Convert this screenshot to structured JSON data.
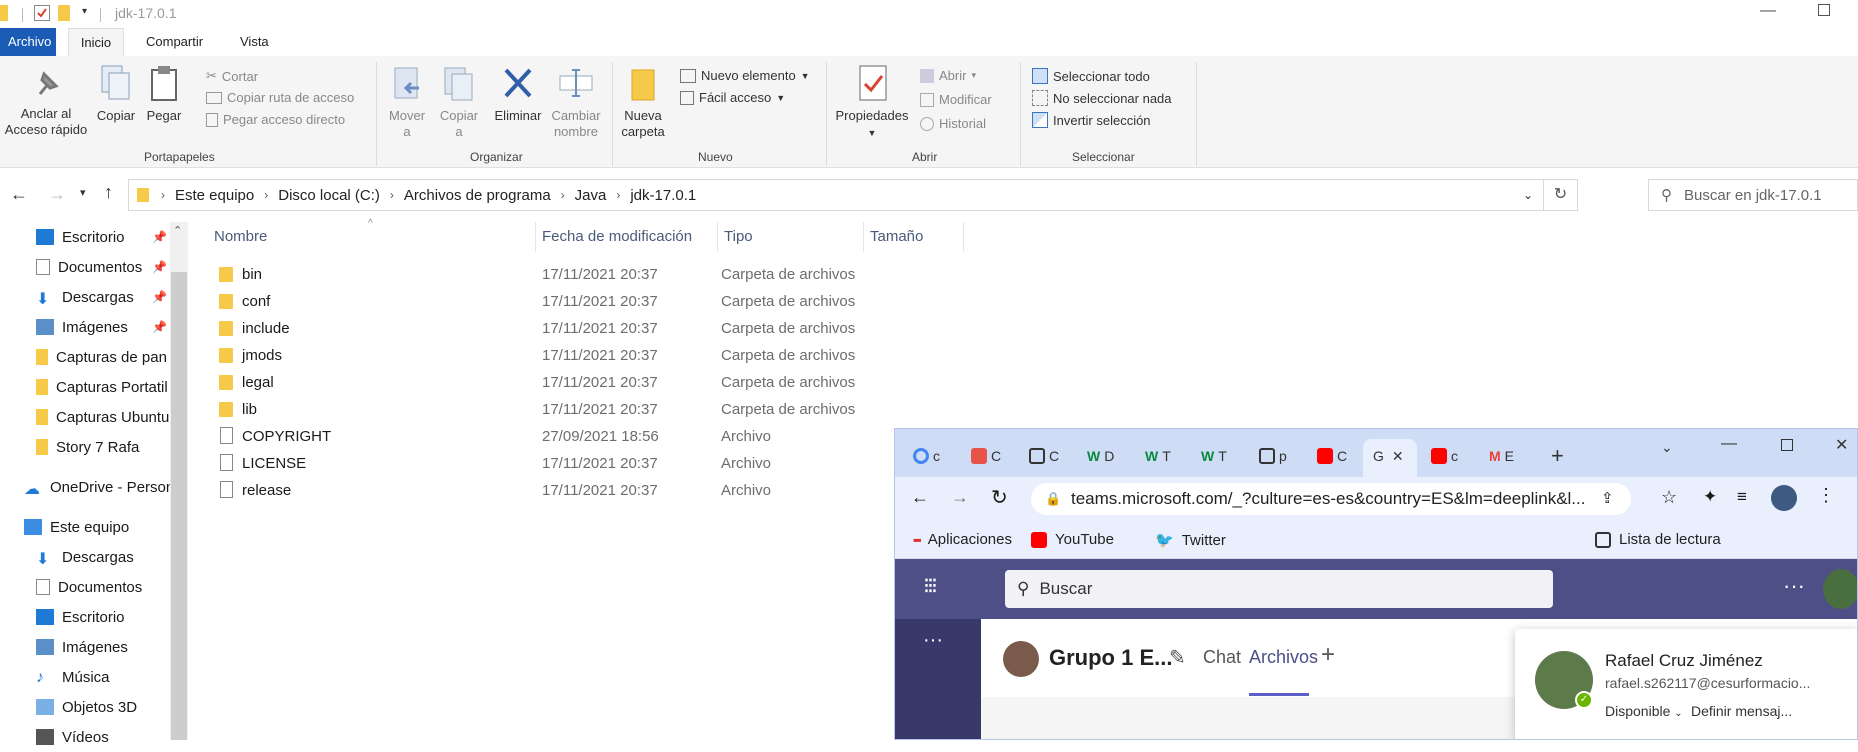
{
  "window": {
    "title": "jdk-17.0.1"
  },
  "ribbon_tabs": [
    "Archivo",
    "Inicio",
    "Compartir",
    "Vista"
  ],
  "ribbon": {
    "portapapeles": {
      "group_label": "Portapapeles",
      "pin_label_1": "Anclar al",
      "pin_label_2": "Acceso rápido",
      "copy_label": "Copiar",
      "paste_label": "Pegar",
      "cut_label": "Cortar",
      "copy_path_label": "Copiar ruta de acceso",
      "paste_shortcut_label": "Pegar acceso directo"
    },
    "organizar": {
      "group_label": "Organizar",
      "move_label_1": "Mover",
      "move_label_2": "a",
      "copyto_label_1": "Copiar",
      "copyto_label_2": "a",
      "delete_label": "Eliminar",
      "rename_label_1": "Cambiar",
      "rename_label_2": "nombre"
    },
    "nuevo": {
      "group_label": "Nuevo",
      "newfolder_label_1": "Nueva",
      "newfolder_label_2": "carpeta",
      "newitem_label": "Nuevo elemento",
      "easyaccess_label": "Fácil acceso"
    },
    "abrir": {
      "group_label": "Abrir",
      "properties_label": "Propiedades",
      "open_label": "Abrir",
      "edit_label": "Modificar",
      "history_label": "Historial"
    },
    "seleccionar": {
      "group_label": "Seleccionar",
      "select_all_label": "Seleccionar todo",
      "select_none_label": "No seleccionar nada",
      "invert_label": "Invertir selección"
    }
  },
  "address": {
    "crumbs": [
      "Este equipo",
      "Disco local (C:)",
      "Archivos de programa",
      "Java",
      "jdk-17.0.1"
    ],
    "search_placeholder": "Buscar en jdk-17.0.1"
  },
  "nav": {
    "quick": [
      {
        "label": "Escritorio",
        "pinned": true
      },
      {
        "label": "Documentos",
        "pinned": true
      },
      {
        "label": "Descargas",
        "pinned": true
      },
      {
        "label": "Imágenes",
        "pinned": true
      },
      {
        "label": "Capturas de pan",
        "pinned": false
      },
      {
        "label": "Capturas Portatil",
        "pinned": false
      },
      {
        "label": "Capturas Ubuntu",
        "pinned": false
      },
      {
        "label": "Story 7 Rafa",
        "pinned": false
      }
    ],
    "onedrive": "OneDrive - Person",
    "thispc": "Este equipo",
    "pc_items": [
      "Descargas",
      "Documentos",
      "Escritorio",
      "Imágenes",
      "Música",
      "Objetos 3D",
      "Vídeos"
    ]
  },
  "columns": {
    "name": "Nombre",
    "modified": "Fecha de modificación",
    "type": "Tipo",
    "size": "Tamaño"
  },
  "files": [
    {
      "name": "bin",
      "date": "17/11/2021 20:37",
      "type": "Carpeta de archivos",
      "kind": "folder"
    },
    {
      "name": "conf",
      "date": "17/11/2021 20:37",
      "type": "Carpeta de archivos",
      "kind": "folder"
    },
    {
      "name": "include",
      "date": "17/11/2021 20:37",
      "type": "Carpeta de archivos",
      "kind": "folder"
    },
    {
      "name": "jmods",
      "date": "17/11/2021 20:37",
      "type": "Carpeta de archivos",
      "kind": "folder"
    },
    {
      "name": "legal",
      "date": "17/11/2021 20:37",
      "type": "Carpeta de archivos",
      "kind": "folder"
    },
    {
      "name": "lib",
      "date": "17/11/2021 20:37",
      "type": "Carpeta de archivos",
      "kind": "folder"
    },
    {
      "name": "COPYRIGHT",
      "date": "27/09/2021 18:56",
      "type": "Archivo",
      "kind": "file"
    },
    {
      "name": "LICENSE",
      "date": "17/11/2021 20:37",
      "type": "Archivo",
      "kind": "file"
    },
    {
      "name": "release",
      "date": "17/11/2021 20:37",
      "type": "Archivo",
      "kind": "file"
    }
  ],
  "chrome": {
    "tabs": [
      {
        "letter": "c",
        "icon": "google-icon",
        "color": "#4285f4"
      },
      {
        "letter": "C",
        "icon": "app-icon",
        "color": "#e8534a"
      },
      {
        "letter": "C",
        "icon": "cube-icon",
        "color": "#333333"
      },
      {
        "letter": "D",
        "icon": "wordpress-icon",
        "color": "#0b8a3e"
      },
      {
        "letter": "T",
        "icon": "wordpress-icon",
        "color": "#0b8a3e"
      },
      {
        "letter": "T",
        "icon": "wordpress-icon",
        "color": "#0b8a3e"
      },
      {
        "letter": "p",
        "icon": "cube-icon",
        "color": "#333333"
      },
      {
        "letter": "C",
        "icon": "youtube-icon",
        "color": "#ff0000"
      },
      {
        "letter": "G",
        "icon": "",
        "color": "#888888",
        "active": true
      },
      {
        "letter": "c",
        "icon": "youtube-icon",
        "color": "#ff0000"
      },
      {
        "letter": "E",
        "icon": "gmail-icon",
        "color": "#ea4335"
      }
    ],
    "url": "teams.microsoft.com/_?culture=es-es&country=ES&lm=deeplink&l...",
    "bookmarks": [
      "Aplicaciones",
      "YouTube",
      "Twitter"
    ],
    "reading_list": "Lista de lectura"
  },
  "teams": {
    "search_placeholder": "Buscar",
    "channel_title": "Grupo 1 E...",
    "tab_chat": "Chat",
    "tab_files": "Archivos",
    "profile_name": "Rafael Cruz Jiménez",
    "profile_email": "rafael.s262117@cesurformacio...",
    "status": "Disponible",
    "set_message": "Definir mensaj..."
  },
  "colors": {
    "file_tab": "#1a5bb5",
    "folder": "#f7c948",
    "teams_purple": "#4d4f86",
    "chrome_tabbar": "#cfdcf6"
  }
}
